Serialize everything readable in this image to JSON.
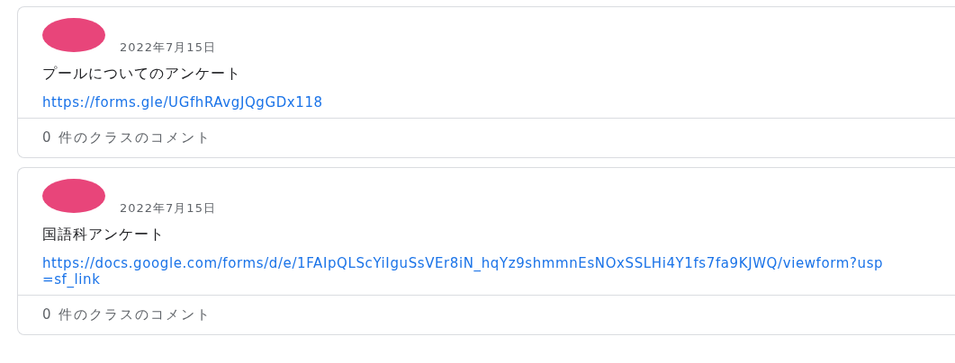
{
  "posts": [
    {
      "date": "2022年7月15日",
      "title": "プールについてのアンケート",
      "link": "https://forms.gle/UGfhRAvgJQgGDx118",
      "comments": "0 件のクラスのコメント"
    },
    {
      "date": "2022年7月15日",
      "title": "国語科アンケート",
      "link": "https://docs.google.com/forms/d/e/1FAIpQLScYiIguSsVEr8iN_hqYz9shmmnEsNOxSSLHi4Y1fs7fa9KJWQ/viewform?usp=sf_link",
      "comments": "0 件のクラスのコメント"
    }
  ]
}
